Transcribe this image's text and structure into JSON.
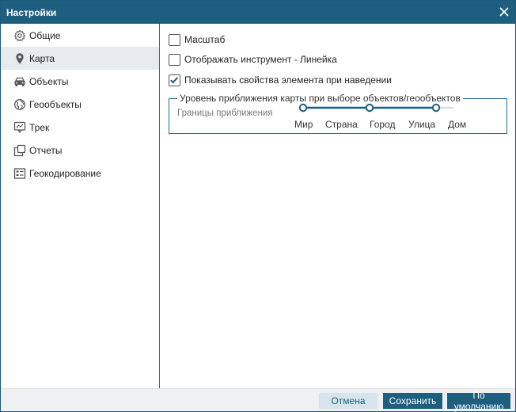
{
  "window": {
    "title": "Настройки"
  },
  "sidebar": {
    "items": [
      {
        "label": "Общие",
        "icon": "gear-icon",
        "active": false
      },
      {
        "label": "Карта",
        "icon": "map-pin-icon",
        "active": true
      },
      {
        "label": "Объекты",
        "icon": "car-icon",
        "active": false
      },
      {
        "label": "Геообъекты",
        "icon": "globe-icon",
        "active": false
      },
      {
        "label": "Трек",
        "icon": "track-icon",
        "active": false
      },
      {
        "label": "Отчеты",
        "icon": "reports-icon",
        "active": false
      },
      {
        "label": "Геокодирование",
        "icon": "geocoding-icon",
        "active": false
      }
    ]
  },
  "map_settings": {
    "scale_label": "Масштаб",
    "scale_checked": false,
    "ruler_label": "Отображать инструмент - Линейка",
    "ruler_checked": false,
    "hover_label": "Показывать свойства элемента при наведении",
    "hover_checked": true,
    "zoom_group": {
      "legend": "Уровень приближения карты при выборе объектов/геообъектов",
      "label": "Границы приближения",
      "levels": [
        "Мир",
        "Страна",
        "Город",
        "Улица",
        "Дом"
      ],
      "range_min_index": 0,
      "range_max_index": 3
    }
  },
  "footer": {
    "cancel_label": "Отмена",
    "save_label": "Сохранить",
    "default_label": "По умолчанию"
  },
  "colors": {
    "titlebar": "#1e5f80",
    "accent": "#1e5f80",
    "active_item_bg": "#e8ebee",
    "slider_track": "#1e5f80",
    "slider_rest": "#cfe0ea"
  }
}
